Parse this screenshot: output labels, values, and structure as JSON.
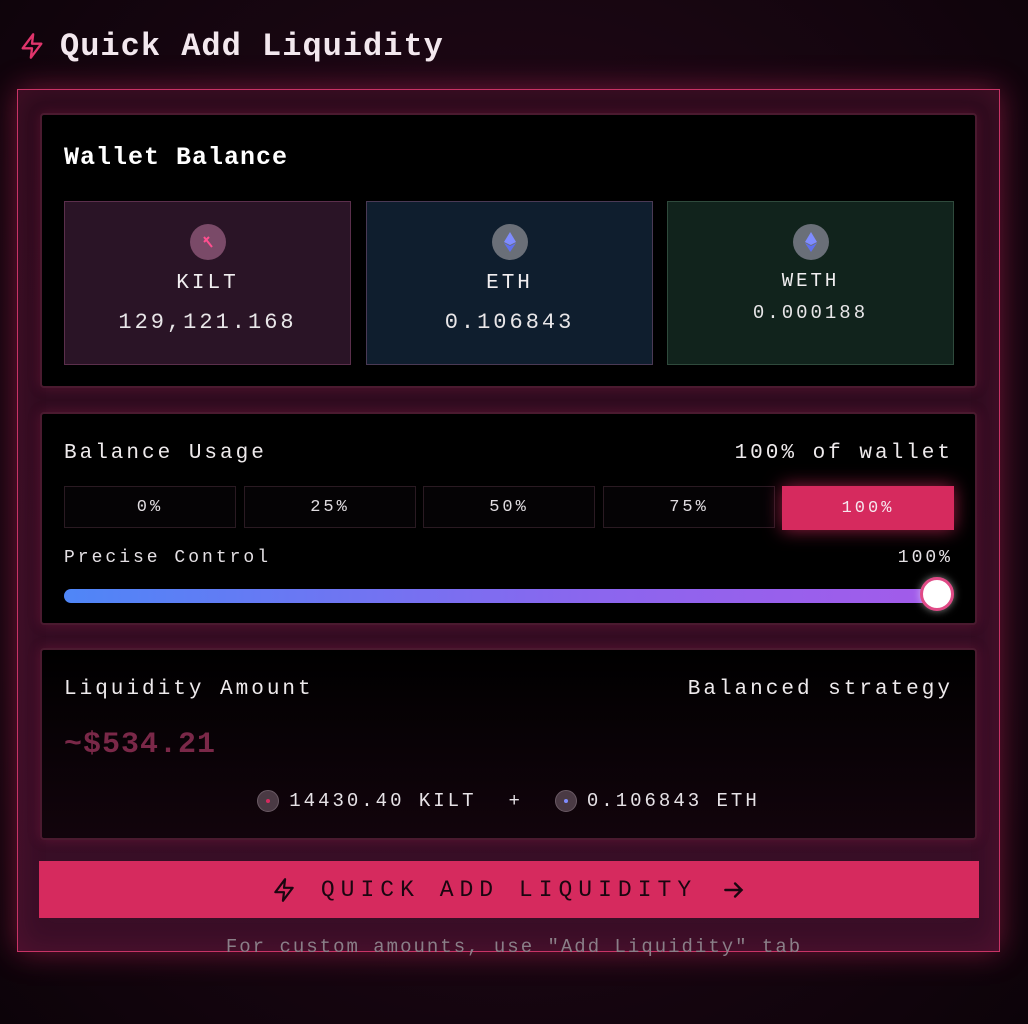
{
  "header": {
    "title": "Quick Add Liquidity",
    "icon": "bolt-icon",
    "accent": "#e0356c"
  },
  "wallet": {
    "title": "Wallet Balance",
    "tokens": [
      {
        "symbol": "KILT",
        "balance": "129,121.168",
        "icon": "kilt-icon"
      },
      {
        "symbol": "ETH",
        "balance": "0.106843",
        "icon": "ethereum-icon"
      },
      {
        "symbol": "WETH",
        "balance": "0.000188",
        "icon": "ethereum-icon"
      }
    ]
  },
  "usage": {
    "title": "Balance Usage",
    "summary": "100% of wallet",
    "options": [
      "0%",
      "25%",
      "50%",
      "75%",
      "100%"
    ],
    "selected": "100%",
    "precise_label": "Precise Control",
    "precise_value": "100%",
    "slider_fraction": 1.0
  },
  "liquidity": {
    "title": "Liquidity Amount",
    "strategy": "Balanced strategy",
    "usd_value": "~$534.21",
    "amount_a": "14430.40 KILT",
    "plus": "+",
    "amount_b": "0.106843 ETH"
  },
  "cta": {
    "label": "QUICK ADD LIQUIDITY",
    "color": "#d62a5e"
  },
  "hint": "For custom amounts, use \"Add Liquidity\" tab"
}
